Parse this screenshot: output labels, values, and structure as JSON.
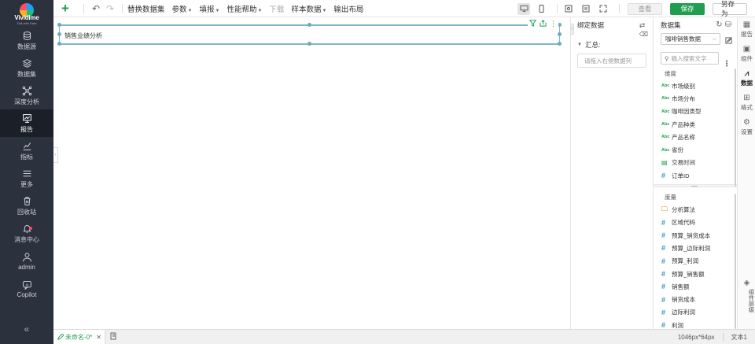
{
  "app": {
    "logo_text": "Vividime",
    "logo_sub": "Talk with Data"
  },
  "nav": {
    "items": [
      {
        "label": "数据源",
        "icon": "database-icon"
      },
      {
        "label": "数据集",
        "icon": "layers-icon"
      },
      {
        "label": "深度分析",
        "icon": "network-icon"
      },
      {
        "label": "报告",
        "icon": "report-icon"
      },
      {
        "label": "指标",
        "icon": "metrics-icon"
      },
      {
        "label": "更多",
        "icon": "menu-icon"
      },
      {
        "label": "回收站",
        "icon": "trash-icon"
      },
      {
        "label": "消息中心",
        "icon": "bell-icon"
      },
      {
        "label": "admin",
        "icon": "user-icon"
      },
      {
        "label": "Copilot",
        "icon": "copilot-icon"
      }
    ],
    "active": "报告",
    "collapse": "«"
  },
  "toolbar": {
    "menus": [
      {
        "label": "替换数据集",
        "caret": false,
        "disabled": false
      },
      {
        "label": "参数",
        "caret": true,
        "disabled": false
      },
      {
        "label": "填报",
        "caret": true,
        "disabled": false
      },
      {
        "label": "性能帮助",
        "caret": true,
        "disabled": false
      },
      {
        "label": "下载",
        "caret": false,
        "disabled": true
      },
      {
        "label": "样本数据",
        "caret": true,
        "disabled": false
      },
      {
        "label": "输出布局",
        "caret": false,
        "disabled": false
      }
    ],
    "view_label": "查看",
    "save_label": "保存",
    "saveas_label": "另存为"
  },
  "canvas": {
    "component_title": "销售业绩分析"
  },
  "bind_panel": {
    "title": "绑定数据",
    "summary_label": "汇总:",
    "drop_placeholder": "请拖入右侧数据列"
  },
  "data_panel": {
    "title": "数据集",
    "dataset": "咖啡销售数据",
    "search_placeholder": "输入搜索文字",
    "dimension_label": "维度",
    "dimensions": [
      {
        "name": "市场级别",
        "type": "text"
      },
      {
        "name": "市场分布",
        "type": "text"
      },
      {
        "name": "咖啡因类型",
        "type": "text"
      },
      {
        "name": "产品种类",
        "type": "text"
      },
      {
        "name": "产品名称",
        "type": "text"
      },
      {
        "name": "省份",
        "type": "text"
      },
      {
        "name": "交易时间",
        "type": "date"
      },
      {
        "name": "订单ID",
        "type": "number"
      }
    ],
    "measure_label": "度量",
    "measures": [
      {
        "name": "分析算法",
        "type": "folder"
      },
      {
        "name": "区域代码",
        "type": "number"
      },
      {
        "name": "预算_销货成本",
        "type": "number"
      },
      {
        "name": "预算_边际利润",
        "type": "number"
      },
      {
        "name": "预算_利润",
        "type": "number"
      },
      {
        "name": "预算_销售额",
        "type": "number"
      },
      {
        "name": "销售额",
        "type": "number"
      },
      {
        "name": "销货成本",
        "type": "number"
      },
      {
        "name": "边际利润",
        "type": "number"
      },
      {
        "name": "利润",
        "type": "number"
      }
    ]
  },
  "side_tabs": {
    "items": [
      {
        "label": "报告",
        "icon": "report-tab-icon"
      },
      {
        "label": "组件",
        "icon": "component-icon"
      },
      {
        "label": "数据",
        "icon": "data-icon"
      },
      {
        "label": "格式",
        "icon": "format-icon"
      },
      {
        "label": "设置",
        "icon": "settings-icon"
      }
    ],
    "active": "数据",
    "layers_label": "组件层级"
  },
  "bottom": {
    "page_tab": "未命名-0*",
    "size": "1046px*64px",
    "component_name": "文本1"
  }
}
